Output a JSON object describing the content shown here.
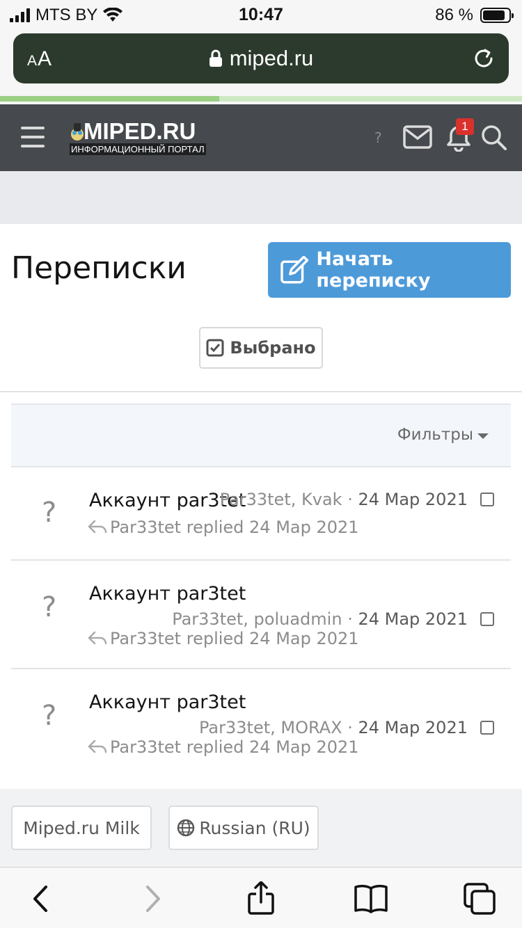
{
  "status": {
    "carrier": "MTS BY",
    "time": "10:47",
    "battery_text": "86 %",
    "battery_level": 0.86
  },
  "browser": {
    "text_size_label_small": "A",
    "text_size_label_large": "A",
    "url": "miped.ru",
    "load_progress": 0.42
  },
  "site": {
    "logo_title": "MIPED.RU",
    "logo_subtitle": "ИНФОРМАЦИОННЫЙ ПОРТАЛ",
    "help_mark": "?",
    "notification_count": "1"
  },
  "page": {
    "title": "Переписки",
    "start_button": "Начать переписку",
    "selected_button": "Выбрано",
    "filters_label": "Фильтры"
  },
  "conversations": [
    {
      "avatar": "?",
      "title": "Аккаунт par3tet",
      "participants": "Par33tet, Kvak",
      "separator": "·",
      "date": "24 Мар 2021",
      "reply": "Par33tet replied 24 Мар 2021"
    },
    {
      "avatar": "?",
      "title": "Аккаунт par3tet",
      "participants": "Par33tet, poluadmin",
      "separator": "·",
      "date": "24 Мар 2021",
      "reply": "Par33tet replied 24 Мар 2021"
    },
    {
      "avatar": "?",
      "title": "Аккаунт par3tet",
      "participants": "Par33tet, MORAX",
      "separator": "·",
      "date": "24 Мар 2021",
      "reply": "Par33tet replied 24 Мар 2021"
    }
  ],
  "footer": {
    "style_chooser": "Miped.ru Milk",
    "language_chooser": "Russian (RU)"
  },
  "colors": {
    "accent": "#4d9ad9",
    "header": "#46494d",
    "badge": "#d9312c",
    "address_bar": "#2b3a2c"
  }
}
